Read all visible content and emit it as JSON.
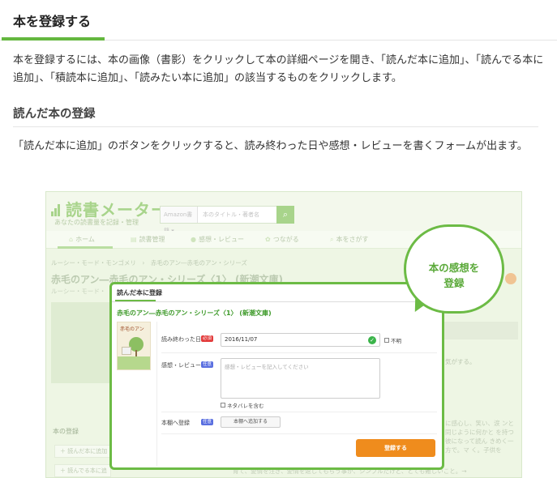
{
  "header": {
    "title": "本を登録する"
  },
  "intro": {
    "text": "本を登録するには、本の画像（書影）をクリックして本の詳細ページを開き、「読んだ本に追加」、「読んでる本に追加」、「積読本に追加」、「読みたい本に追加」の該当するものをクリックします。"
  },
  "section": {
    "heading": "読んだ本の登録",
    "body": "「読んだ本に追加」のボタンをクリックすると、読み終わった日や感想・レビューを書くフォームが出ます。"
  },
  "screenshot": {
    "logo": "読書メーター",
    "tagline": "あなたの読書量を記録・管理",
    "search_select": "Amazon書籍 ▾",
    "search_placeholder": "本のタイトル・著者名",
    "nav": [
      {
        "label": "ホーム",
        "icon": "home-icon"
      },
      {
        "label": "読書管理",
        "icon": "book-icon"
      },
      {
        "label": "感想・レビュー",
        "icon": "chat-icon"
      },
      {
        "label": "つながる",
        "icon": "people-icon"
      },
      {
        "label": "本をさがす",
        "icon": "search-icon"
      }
    ],
    "breadcrumb": "ルーシー・モード・モンゴメリ　›　赤毛のアン―赤毛のアン・シリーズ",
    "bg_title": "赤毛のアン―赤毛のアン・シリーズ〈1〉 (新潮文庫)",
    "bg_subtitle": "ルーシー・モード・",
    "side_label": "本の登録",
    "side_buttons": [
      "＋ 読んだ本に追加",
      "＋ 読んでる本に追加"
    ],
    "right_snippet_1": "気がする。",
    "right_snippet_2": "に感心し、笑い、涙 ンと同じように何かと を持つ彼になって読ん きめく一方で。マ く。子供を",
    "bottom_snippet": "育て、愛情を注ぎ、愛情を返してもらう事が、シンプルだけど、とても難しいこと。→"
  },
  "modal": {
    "title": "読んだ本に登録",
    "book_title": "赤毛のアン―赤毛のアン・シリーズ〈1〉 (新潮文庫)",
    "cover_text": "赤毛のアン",
    "date_label": "読み終わった日",
    "required_badge": "必須",
    "date_value": "2016/11/07",
    "unknown_label": "不明",
    "review_label": "感想・レビュー",
    "optional_badge": "任意",
    "review_placeholder": "感想・レビューを記入してください",
    "spoiler_label": "ネタバレを含む",
    "shelf_label": "本棚へ登録",
    "shelf_button": "本棚へ追加する",
    "register_button": "登録する"
  },
  "callout": {
    "line1": "本の感想を",
    "line2": "登録"
  },
  "colors": {
    "accent_green": "#64b73f",
    "register_orange": "#ef8c1d",
    "required_red": "#e23a3a",
    "optional_blue": "#5a6fe0"
  }
}
